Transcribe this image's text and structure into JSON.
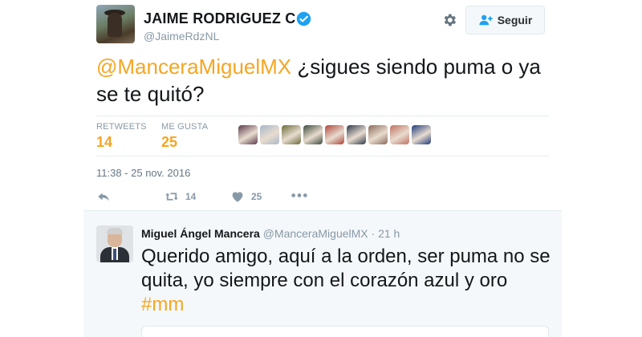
{
  "tweet": {
    "author": {
      "display_name": "JAIME RODRIGUEZ C",
      "username": "@JaimeRdzNL",
      "verified": true,
      "avatar_icon": "avatar-rider-on-horse"
    },
    "follow_button_label": "Seguir",
    "text_mention": "@ManceraMiguelMX",
    "text_body": " ¿sigues siendo puma o ya se te quitó?",
    "stats": {
      "retweets_label": "RETWEETS",
      "retweets_value": "14",
      "likes_label": "ME GUSTA",
      "likes_value": "25"
    },
    "liker_avatars": [
      "#5a3a4a",
      "#a8b8c8",
      "#6b6b3a",
      "#3a4a3a",
      "#b0443a",
      "#2e3a4a",
      "#8a6a5a",
      "#c07060",
      "#1e3a7a"
    ],
    "timestamp": "11:38 - 25 nov. 2016",
    "actions": {
      "reply_icon": "reply-icon",
      "retweet_icon": "retweet-icon",
      "retweet_count": "14",
      "like_icon": "heart-icon",
      "like_count": "25",
      "more_icon": "more-dots-icon"
    }
  },
  "reply": {
    "display_name": "Miguel Ángel Mancera",
    "username": "@ManceraMiguelMX",
    "time": "· 21 h",
    "text_body": "Querido amigo, aquí a la orden, ser puma no se quita, yo siempre con el corazón azul y oro ",
    "hashtag": "#mm"
  },
  "colors": {
    "accent": "#f5a623",
    "muted": "#8899a6",
    "verified_blue": "#1da1f2",
    "reply_bg": "#f5f8fa"
  }
}
